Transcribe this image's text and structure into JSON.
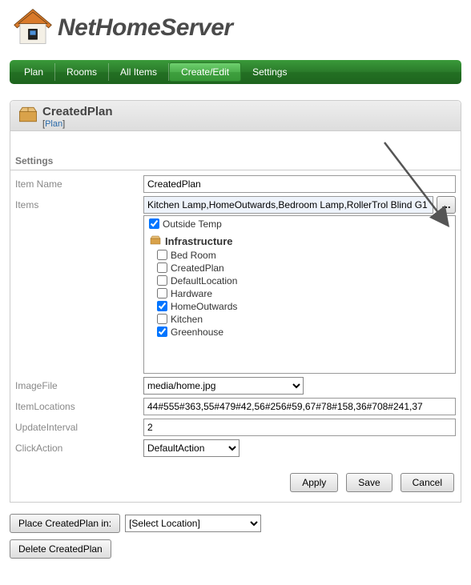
{
  "app_name": "NetHomeServer",
  "nav": {
    "items": [
      {
        "label": "Plan",
        "active": false
      },
      {
        "label": "Rooms",
        "active": false
      },
      {
        "label": "All Items",
        "active": false
      },
      {
        "label": "Create/Edit",
        "active": true
      },
      {
        "label": "Settings",
        "active": false
      }
    ]
  },
  "panel": {
    "title": "CreatedPlan",
    "type_label": "Plan",
    "section": "Settings",
    "fields": {
      "item_name": {
        "label": "Item Name",
        "value": "CreatedPlan"
      },
      "items": {
        "label": "Items",
        "value": "Kitchen Lamp,HomeOutwards,Bedroom Lamp,RollerTrol Blind G1",
        "browse": "..."
      },
      "image_file": {
        "label": "ImageFile",
        "value": "media/home.jpg"
      },
      "item_locations": {
        "label": "ItemLocations",
        "value": "44#555#363,55#479#42,56#256#59,67#78#158,36#708#241,37"
      },
      "update_interval": {
        "label": "UpdateInterval",
        "value": "2"
      },
      "click_action": {
        "label": "ClickAction",
        "value": "DefaultAction"
      }
    },
    "list": {
      "top_item": {
        "label": "Outside Temp",
        "checked": true
      },
      "group": "Infrastructure",
      "items": [
        {
          "label": "Bed Room",
          "checked": false
        },
        {
          "label": "CreatedPlan",
          "checked": false
        },
        {
          "label": "DefaultLocation",
          "checked": false
        },
        {
          "label": "Hardware",
          "checked": false
        },
        {
          "label": "HomeOutwards",
          "checked": true
        },
        {
          "label": "Kitchen",
          "checked": false
        },
        {
          "label": "Greenhouse",
          "checked": true
        }
      ]
    },
    "buttons": {
      "apply": "Apply",
      "save": "Save",
      "cancel": "Cancel"
    }
  },
  "footer": {
    "place_btn": "Place CreatedPlan in:",
    "place_select": "[Select Location]",
    "delete_btn": "Delete CreatedPlan"
  }
}
